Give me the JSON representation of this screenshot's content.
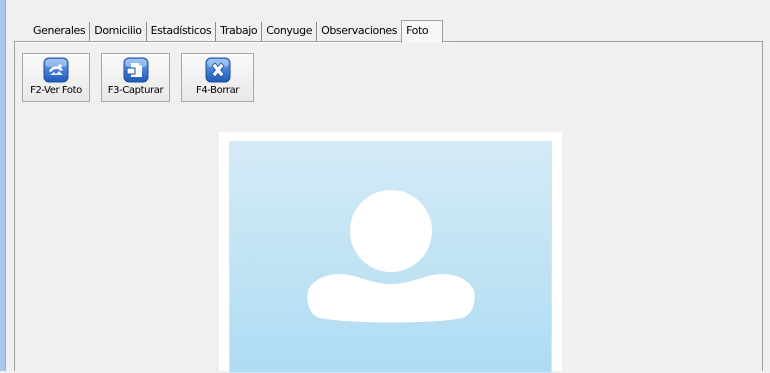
{
  "tabs": [
    {
      "label": "Generales",
      "active": false
    },
    {
      "label": "Domicilio",
      "active": false
    },
    {
      "label": "Estadísticos",
      "active": false
    },
    {
      "label": "Trabajo",
      "active": false
    },
    {
      "label": "Conyuge",
      "active": false
    },
    {
      "label": "Observaciones",
      "active": false
    },
    {
      "label": "Foto",
      "active": true
    }
  ],
  "toolbar": {
    "view_photo_label": "F2-Ver Foto",
    "capture_label": "F3-Capturar",
    "delete_label": "F4-Borrar"
  },
  "icons": {
    "view_photo": "view-photo-icon",
    "capture": "capture-icon",
    "delete": "delete-icon",
    "placeholder": "user-avatar-placeholder-icon"
  },
  "colors": {
    "photo_background_top": "#d5ebf6",
    "photo_background_bottom": "#aedcf3",
    "icon_blue": "#2f6fd1"
  }
}
